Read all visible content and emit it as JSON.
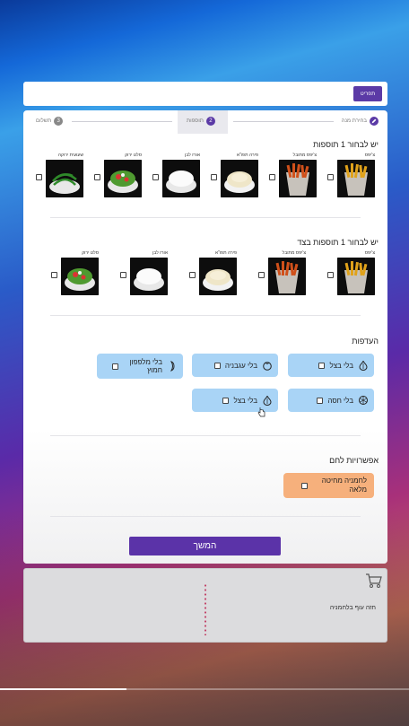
{
  "header": {
    "button_label": "תפריט"
  },
  "stepper": {
    "steps": [
      {
        "num": "",
        "label": "בחירת מנה",
        "state": "done"
      },
      {
        "num": "2",
        "label": "תוספות",
        "state": "active"
      },
      {
        "num": "3",
        "label": "תשלום",
        "state": "pending"
      }
    ]
  },
  "section1": {
    "title": "יש לבחור 1 תוספות",
    "items": [
      {
        "label": "צ'יפס",
        "icon": "fries"
      },
      {
        "label": "צ'יפס מתובל",
        "icon": "spiced-fries"
      },
      {
        "label": "פירה תפו\"א",
        "icon": "mashed-potato"
      },
      {
        "label": "אורז לבן",
        "icon": "white-rice"
      },
      {
        "label": "סלט ירוק",
        "icon": "green-salad"
      },
      {
        "label": "שעועית ירוקה",
        "icon": "green-beans"
      }
    ]
  },
  "section2": {
    "title": "יש לבחור 1 תוספות בצד",
    "items": [
      {
        "label": "צ'יפס",
        "icon": "fries"
      },
      {
        "label": "צ'יפס מתובל",
        "icon": "spiced-fries"
      },
      {
        "label": "פירה תפו\"א",
        "icon": "mashed-potato"
      },
      {
        "label": "אורז לבן",
        "icon": "white-rice"
      },
      {
        "label": "סלט ירוק",
        "icon": "green-salad"
      }
    ]
  },
  "preferences": {
    "title": "העדפות",
    "items": [
      {
        "label": "בלי בצל",
        "icon": "onion-icon"
      },
      {
        "label": "בלי עגבניה",
        "icon": "tomato-icon"
      },
      {
        "label": "בלי מלפפון חמוץ",
        "icon": "pickle-icon"
      },
      {
        "label": "בלי חסה",
        "icon": "lettuce-icon"
      },
      {
        "label": "בלי בצל",
        "icon": "onion-icon"
      }
    ]
  },
  "bread": {
    "title": "אפשרויות לחם",
    "option_label": "לחמניה מחיטה מלאה"
  },
  "continue_label": "המשך",
  "cart": {
    "item_text": "חזה עוף בלחמניה"
  },
  "video_progress": 0.31,
  "colors": {
    "primary": "#5b33a8",
    "pref_bg": "#a9d4f6",
    "bread_bg": "#f6b07c"
  }
}
